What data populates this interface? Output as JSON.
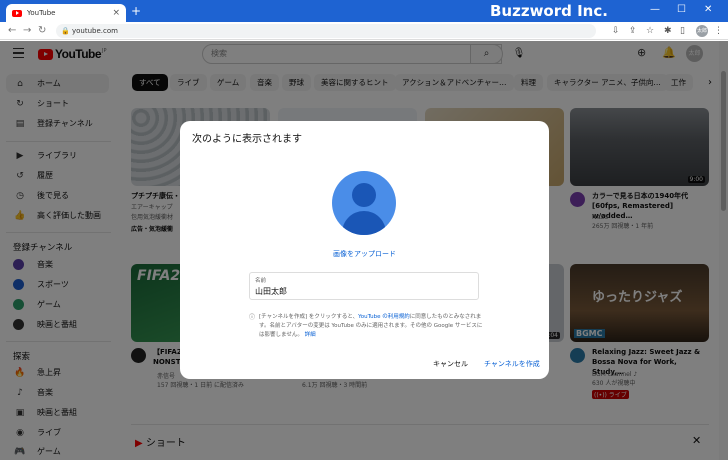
{
  "browser": {
    "tab_title": "YouTube",
    "tab_close": "×",
    "new_tab": "+",
    "url": "youtube.com",
    "watermark": "Buzzword Inc.",
    "profile_initials": "太郎",
    "win_min": "—",
    "win_max": "☐",
    "win_close": "✕"
  },
  "youtube": {
    "logo_text": "YouTube",
    "logo_region": "JP",
    "search_placeholder": "検索",
    "avatar_initials": "太郎"
  },
  "sidebar": {
    "primary": [
      {
        "label": "ホーム",
        "icon": "home-icon",
        "glyph": "⌂"
      },
      {
        "label": "ショート",
        "icon": "shorts-icon",
        "glyph": "↻"
      },
      {
        "label": "登録チャンネル",
        "icon": "subscriptions-icon",
        "glyph": "▤"
      }
    ],
    "library": [
      {
        "label": "ライブラリ",
        "icon": "library-icon",
        "glyph": "▶"
      },
      {
        "label": "履歴",
        "icon": "history-icon",
        "glyph": "↺"
      },
      {
        "label": "後で見る",
        "icon": "watch-later-icon",
        "glyph": "◷"
      },
      {
        "label": "高く評価した動画",
        "icon": "like-icon",
        "glyph": "👍"
      }
    ],
    "subscriptions_heading": "登録チャンネル",
    "subscriptions": [
      {
        "label": "音楽",
        "color": "#5b3fa8"
      },
      {
        "label": "スポーツ",
        "color": "#1f5fcf"
      },
      {
        "label": "ゲーム",
        "color": "#2d9f6a"
      },
      {
        "label": "映画と番組",
        "color": "#333333"
      }
    ],
    "explore_heading": "探索",
    "explore": [
      {
        "label": "急上昇",
        "icon": "trending-icon",
        "glyph": "🔥"
      },
      {
        "label": "音楽",
        "icon": "music-icon",
        "glyph": "♪"
      },
      {
        "label": "映画と番組",
        "icon": "movies-icon",
        "glyph": "▣"
      },
      {
        "label": "ライブ",
        "icon": "live-icon",
        "glyph": "◉"
      },
      {
        "label": "ゲーム",
        "icon": "gaming-icon",
        "glyph": "🎮"
      }
    ]
  },
  "chips": [
    "すべて",
    "ライブ",
    "ゲーム",
    "音楽",
    "野球",
    "美容に関するヒント",
    "アクション＆アドベンチャー…",
    "料理",
    "キャラクター アニメ、子供向…",
    "工作"
  ],
  "videos": {
    "v1": {
      "title": "プチプチ康伝・",
      "meta1": "エアーキャップ",
      "meta2": "包用気泡緩衝材",
      "meta3": "広告・気泡緩衝"
    },
    "v2": {
      "title": "カラーで見る日本の1940年代 [60fps, Remastered] w/added…",
      "channel": "NASS",
      "meta": "265万 回視聴・1 年前",
      "duration": "9:00"
    },
    "v3": {
      "title": "【FIFA2 NONST",
      "channel": "赤信号",
      "meta": "157 回視聴・1 日前 に配信済み"
    },
    "v4": {
      "meta": "6.1万 回視聴・3 時間前",
      "duration": "2:04"
    },
    "v5": {
      "title": "Relaxing Jazz: Sweet Jazz & Bossa Nova for Work, Study,…",
      "channel": "BGM channel ♪",
      "meta": "630 人が視聴中",
      "live": "((•)) ライブ",
      "thumb_text": "ゆったりジャズ",
      "brand": "BGMC"
    },
    "fifa_text": "FIFA2"
  },
  "shorts_label": "ショート",
  "dialog": {
    "title": "次のように表示されます",
    "upload_link": "画像をアップロード",
    "name_label": "名前",
    "name_value": "山田太郎",
    "terms_pre": "[チャンネルを作成] をクリックすると、",
    "terms_link": "YouTube の利用規約",
    "terms_post": "に同意したものとみなされます。名前とアバターの変更は YouTube のみに適用されます。その他の Google サービスには影響しません。",
    "terms_detail": "詳細",
    "cancel": "キャンセル",
    "create": "チャンネルを作成"
  }
}
